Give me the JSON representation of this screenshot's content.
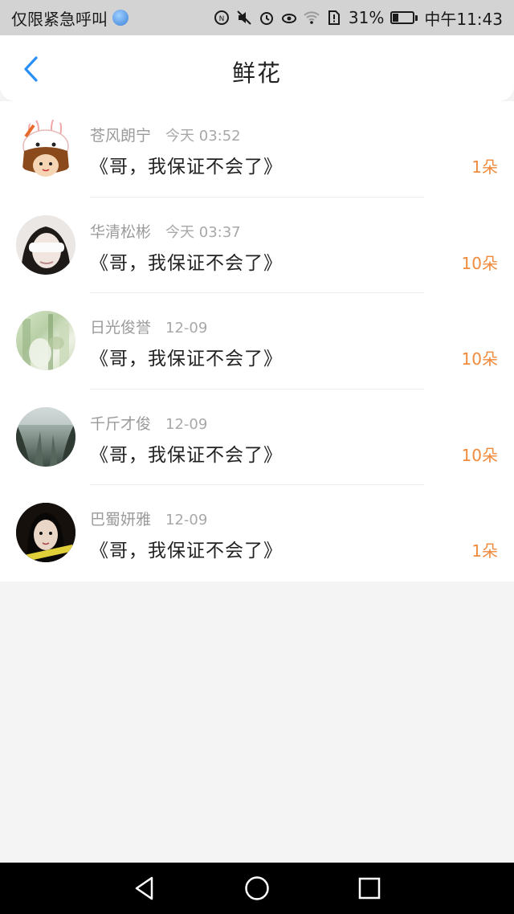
{
  "status_bar": {
    "carrier": "仅限紧急呼叫",
    "battery_percent": "31%",
    "battery_level": 0.31,
    "time": "中午11:43",
    "icons": [
      "globe-icon",
      "data-saver-icon",
      "mute-icon",
      "alarm-icon",
      "eye-icon",
      "wifi-icon",
      "sim-alert-icon",
      "battery-icon"
    ]
  },
  "header": {
    "title": "鲜花",
    "back_icon": "chevron-left-icon",
    "accent_color": "#2a8ff7"
  },
  "list": {
    "items": [
      {
        "name": "苍风朗宁",
        "time": "今天 03:52",
        "message": "《哥，我保证不会了》",
        "count": "1朵",
        "avatar": "rabbit-avatar"
      },
      {
        "name": "华清松彬",
        "time": "今天 03:37",
        "message": "《哥，我保证不会了》",
        "count": "10朵",
        "avatar": "person-avatar"
      },
      {
        "name": "日光俊誉",
        "time": "12-09",
        "message": "《哥，我保证不会了》",
        "count": "10朵",
        "avatar": "green-avatar"
      },
      {
        "name": "千斤才俊",
        "time": "12-09",
        "message": "《哥，我保证不会了》",
        "count": "10朵",
        "avatar": "forest-avatar"
      },
      {
        "name": "巴蜀妍雅",
        "time": "12-09",
        "message": "《哥，我保证不会了》",
        "count": "1朵",
        "avatar": "girl-avatar"
      }
    ],
    "count_color": "#f08a3c"
  },
  "nav_bar": {
    "icons": [
      "back-triangle-icon",
      "home-circle-icon",
      "recents-square-icon"
    ]
  }
}
